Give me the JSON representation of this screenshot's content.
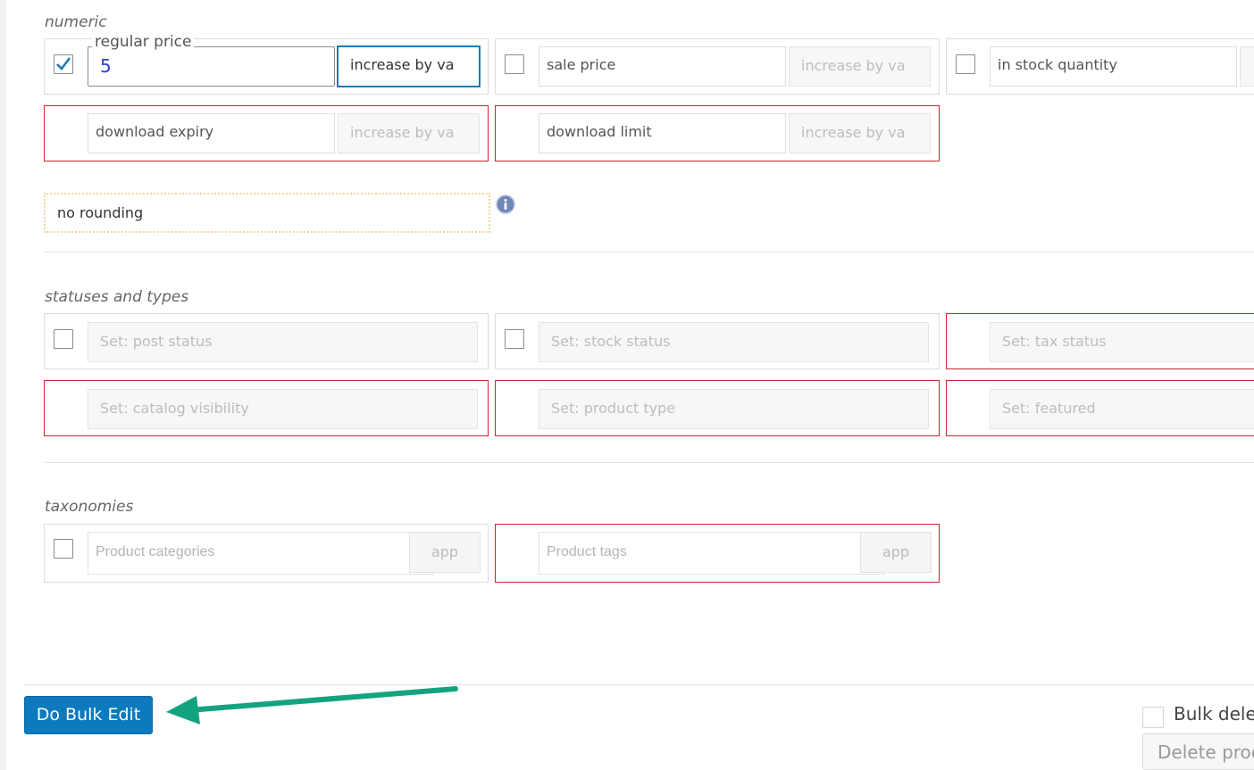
{
  "sections": {
    "numeric": "numeric",
    "statuses": "statuses and types",
    "taxonomies": "taxonomies"
  },
  "numeric": {
    "regular_price": {
      "legend": "regular price",
      "value": "5",
      "mode": "increase by va",
      "checked": true
    },
    "sale_price": {
      "label": "sale price",
      "mode": "increase by va",
      "checked": false
    },
    "stock_qty": {
      "label": "in stock quantity",
      "checked": false
    },
    "download_expiry": {
      "label": "download expiry",
      "mode": "increase by va"
    },
    "download_limit": {
      "label": "download limit",
      "mode": "increase by va"
    },
    "rounding": "no rounding"
  },
  "statuses": {
    "post_status": "Set: post status",
    "stock_status": "Set: stock status",
    "tax_status": "Set: tax status",
    "catalog_visibility": "Set: catalog visibility",
    "product_type": "Set: product type",
    "featured": "Set: featured"
  },
  "taxonomies": {
    "categories_placeholder": "Product categories",
    "tags_placeholder": "Product tags",
    "app_label": "app"
  },
  "footer": {
    "bulk_edit": "Do Bulk Edit",
    "bulk_delete": "Bulk delete",
    "delete_products": "Delete products"
  },
  "colors": {
    "accent": "#0d7abd",
    "error_border": "#c9262b",
    "arrow": "#14a37f"
  }
}
